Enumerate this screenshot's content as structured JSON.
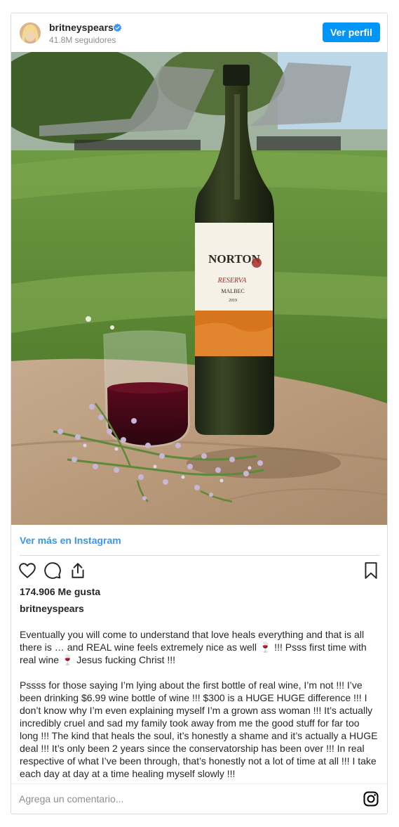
{
  "post": {
    "username": "britneyspears",
    "followers": "41.8M seguidores",
    "view_profile_label": "Ver perfil",
    "view_more_label": "Ver más en Instagram",
    "likes": "174.906 Me gusta",
    "author": "britneyspears",
    "caption_p1": "Eventually you will come to understand that love heals everything and that is all there is … and REAL wine feels extremely nice as well 🍷 !!! Psss first time with real wine 🍷 Jesus fucking Christ !!!",
    "caption_p2": "Pssss for those saying I’m lying about the first bottle of real wine, I’m not !!! I’ve been drinking $6.99 wine bottle of wine !!! $300 is a HUGE HUGE difference !!! I don’t know why I’m even explaining myself I’m a grown ass woman !!! It’s actually incredibly cruel and sad my family took away from me the good stuff for far too long !!! The kind that heals the soul, it’s honestly a shame and it’s actually a HUGE deal !!! It’s only been 2 years since the conservatorship has been over !!! In real respective of what I’ve been through, that’s honestly not a lot of time at all !!! I take each day at day at a time healing myself slowly !!!",
    "comment_placeholder": "Agrega un comentario...",
    "label": {
      "brand": "NORTON",
      "line": "RESERVA",
      "varietal": "MALBEC",
      "vintage": "2019"
    }
  },
  "colors": {
    "accent": "#0095f6",
    "link": "#3897f0",
    "verified": "#3897f0"
  },
  "icons": [
    "verified-badge-icon",
    "heart-icon",
    "comment-icon",
    "share-icon",
    "bookmark-icon",
    "instagram-icon"
  ]
}
